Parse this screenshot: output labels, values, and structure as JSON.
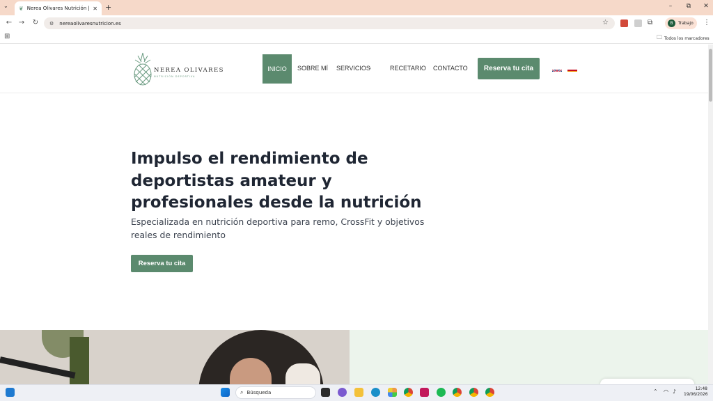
{
  "browser": {
    "tab_title": "Nerea Olivares Nutrición | Nutri",
    "tab_close": "✕",
    "new_tab": "+",
    "url": "nereaolivaresnutricion.es",
    "profile_initial": "B",
    "profile_label": "Trabajo",
    "bookmarks_label": "Todos los marcadores",
    "window_minimize": "–",
    "window_restore": "⧉",
    "window_close": "✕"
  },
  "site": {
    "logo_name": "NEREA OLIVARES",
    "logo_sub": "NUTRICIÓN DEPORTIVA",
    "nav": {
      "inicio": "INICIO",
      "sobre_mi": "SOBRE MÍ",
      "servicios": "SERVICIOS",
      "recetario": "RECETARIO",
      "contacto": "CONTACTO"
    },
    "header_cta": "Reserva tu cita",
    "hero": {
      "title": "Impulso el rendimiento de deportistas amateur y profesionales desde la nutrición",
      "subtitle": "Especializada en nutrición deportiva para remo, CrossFit y objetivos reales de rendimiento",
      "cta": "Reserva tu cita"
    }
  },
  "taskbar": {
    "search_placeholder": "Búsqueda",
    "time": "12:48",
    "date": "19/06/2026"
  },
  "colors": {
    "brand_green": "#5b8a6e",
    "tab_strip": "#f6d9c9",
    "hero_text": "#1f2633"
  }
}
